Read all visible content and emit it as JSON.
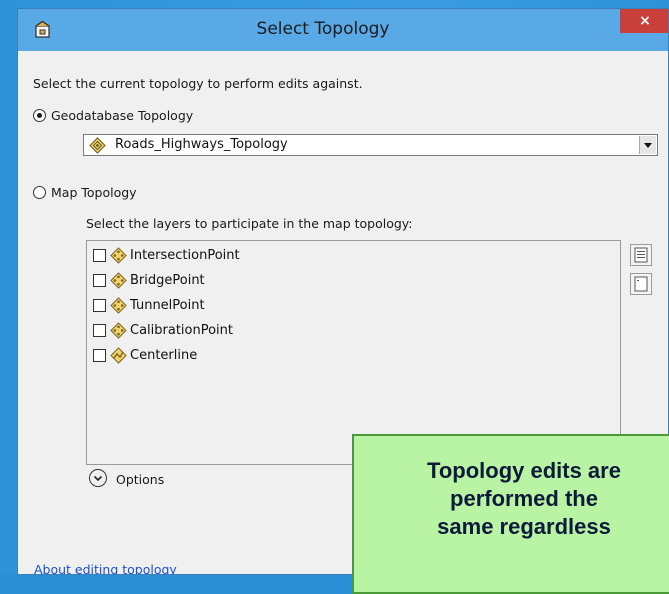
{
  "window": {
    "title": "Select Topology",
    "close_label": "×"
  },
  "instructions": "Select the current topology to perform edits against.",
  "geodatabase": {
    "radio_label": "Geodatabase Topology",
    "selected": true,
    "dropdown_value": "Roads_Highways_Topology"
  },
  "map_topology": {
    "radio_label": "Map Topology",
    "selected": false,
    "layers_prompt": "Select the layers to participate in the map topology:",
    "layers": [
      {
        "label": "IntersectionPoint",
        "checked": false,
        "icon": "point-feature-icon"
      },
      {
        "label": "BridgePoint",
        "checked": false,
        "icon": "point-feature-icon"
      },
      {
        "label": "TunnelPoint",
        "checked": false,
        "icon": "point-feature-icon"
      },
      {
        "label": "CalibrationPoint",
        "checked": false,
        "icon": "point-feature-icon"
      },
      {
        "label": "Centerline",
        "checked": false,
        "icon": "line-feature-icon"
      }
    ]
  },
  "options_label": "Options",
  "about_link": "About editing topology",
  "callout": {
    "lines": [
      "Topology edits are",
      "performed the",
      "same regardless"
    ]
  },
  "colors": {
    "titlebar": "#59a9e6",
    "close": "#c9403a",
    "callout_bg": "#b8f4a4",
    "link": "#1a4fd6"
  }
}
